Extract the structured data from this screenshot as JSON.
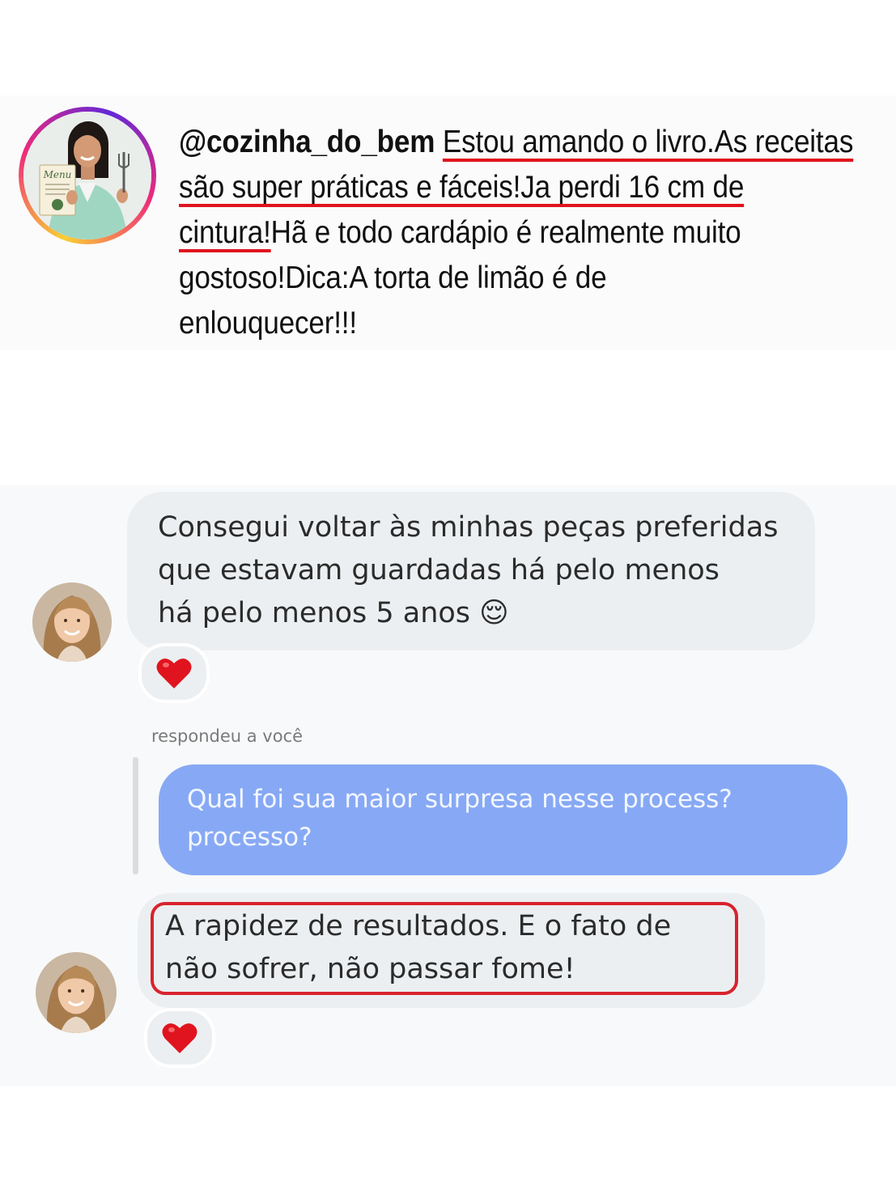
{
  "comment": {
    "handle": "@cozinha_do_bem",
    "line1_rest": "Estou amando o livro.As receitas",
    "line2": "são super práticas e fáceis!Ja perdi 16 cm de",
    "line3_underlined": "cintura!",
    "line3_rest": "Hã e todo cardápio é realmente muito",
    "line4": "gostoso!Dica:A torta de limão é de",
    "line5": "enlouquecer!!!",
    "book_cover_text": "Menu",
    "underline_color": "#e0141e"
  },
  "chat": {
    "message1": {
      "line1": "Consegui voltar às minhas peças preferidas",
      "line2": "que estavam guardadas há pelo menos",
      "line3": "há pelo menos 5 anos",
      "emoji": "😌",
      "reaction": "❤️"
    },
    "reply_label": "respondeu a você",
    "question": {
      "line1": "Qual foi sua maior surpresa nesse process?",
      "line2": "processo?"
    },
    "message2": {
      "line1": "A rapidez de resultados. E o fato de",
      "line2": "não sofrer, não passar fome!",
      "reaction": "❤️"
    },
    "colors": {
      "incoming_bubble": "#eceff1",
      "outgoing_bubble": "#87a9f5",
      "highlight": "#d8232d"
    }
  }
}
